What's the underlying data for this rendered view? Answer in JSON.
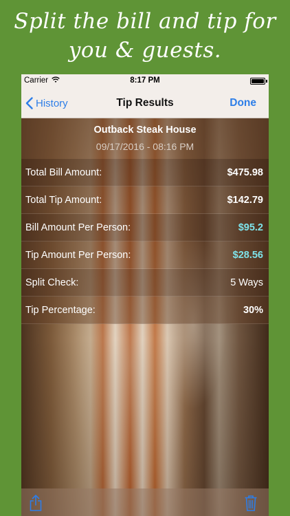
{
  "promo": {
    "line1": "Split the bill and tip for",
    "line2": "you & guests."
  },
  "status_bar": {
    "carrier": "Carrier",
    "time": "8:17 PM"
  },
  "nav": {
    "back_label": "History",
    "title": "Tip Results",
    "done_label": "Done"
  },
  "receipt": {
    "restaurant": "Outback Steak House",
    "datetime": "09/17/2016 - 08:16 PM"
  },
  "rows": [
    {
      "label": "Total Bill Amount:",
      "value": "$475.98"
    },
    {
      "label": "Total Tip Amount:",
      "value": "$142.79"
    },
    {
      "label": "Bill Amount Per Person:",
      "value": "$95.2"
    },
    {
      "label": "Tip Amount Per Person:",
      "value": "$28.56"
    },
    {
      "label": "Split Check:",
      "value": "5 Ways"
    },
    {
      "label": "Tip Percentage:",
      "value": "30%"
    }
  ],
  "colors": {
    "accent_blue": "#2d7ee8",
    "per_person_teal": "#7ee3ea",
    "promo_green": "#5f9436"
  },
  "icons": {
    "back": "chevron-left-icon",
    "share": "share-icon",
    "trash": "trash-icon",
    "wifi": "wifi-icon"
  }
}
